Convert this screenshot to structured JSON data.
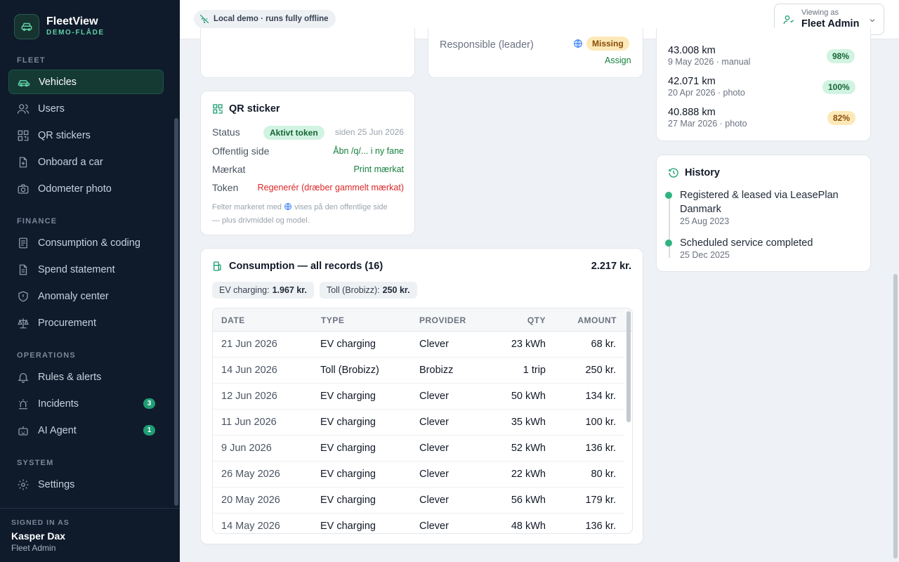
{
  "brand": {
    "name": "FleetView",
    "subtitle": "DEMO-FLÅDE"
  },
  "nav": {
    "sections": {
      "fleet": "FLEET",
      "finance": "FINANCE",
      "operations": "OPERATIONS",
      "system": "SYSTEM"
    },
    "items": {
      "vehicles": "Vehicles",
      "users": "Users",
      "qr_stickers": "QR stickers",
      "onboard": "Onboard a car",
      "odometer": "Odometer photo",
      "consumption": "Consumption & coding",
      "spend": "Spend statement",
      "anomaly": "Anomaly center",
      "procurement": "Procurement",
      "rules": "Rules & alerts",
      "incidents": "Incidents",
      "ai_agent": "AI Agent",
      "settings": "Settings"
    },
    "badges": {
      "incidents": "3",
      "ai_agent": "1"
    }
  },
  "footer": {
    "label": "SIGNED IN AS",
    "user": "Kasper Dax",
    "role": "Fleet Admin"
  },
  "topbar": {
    "demo_pill": "Local demo · runs fully offline",
    "viewing_as_label": "Viewing as",
    "viewing_as_value": "Fleet Admin"
  },
  "responsible": {
    "label": "Responsible (leader)",
    "status": "Missing",
    "action": "Assign"
  },
  "qr": {
    "title": "QR sticker",
    "status_label": "Status",
    "status_value": "Aktivt token",
    "status_since": "siden 25 Jun 2026",
    "public_label": "Offentlig side",
    "public_link": "Åbn /q/... i ny fane",
    "sticker_label": "Mærkat",
    "sticker_link": "Print mærkat",
    "token_label": "Token",
    "token_link": "Regenerér (dræber gammelt mærkat)",
    "note_a": "Felter markeret med",
    "note_b": "vises på den offentlige side",
    "note_c": "— plus drivmiddel og model."
  },
  "readings": [
    {
      "km": "43.008 km",
      "meta": "9 May 2026 · manual",
      "pct": "98%",
      "tone": "g"
    },
    {
      "km": "42.071 km",
      "meta": "20 Apr 2026 · photo",
      "pct": "100%",
      "tone": "g"
    },
    {
      "km": "40.888 km",
      "meta": "27 Mar 2026 · photo",
      "pct": "82%",
      "tone": "y"
    }
  ],
  "history": {
    "title": "History",
    "items": [
      {
        "text": "Registered & leased via LeasePlan Danmark",
        "date": "25 Aug 2023"
      },
      {
        "text": "Scheduled service completed",
        "date": "25 Dec 2025"
      }
    ]
  },
  "consumption": {
    "title": "Consumption — all records (16)",
    "total": "2.217 kr.",
    "chips": [
      {
        "label": "EV charging:",
        "value": "1.967 kr."
      },
      {
        "label": "Toll (Brobizz):",
        "value": "250 kr."
      }
    ],
    "columns": {
      "date": "DATE",
      "type": "TYPE",
      "provider": "PROVIDER",
      "qty": "QTY",
      "amount": "AMOUNT"
    },
    "rows": [
      {
        "date": "21 Jun 2026",
        "type": "EV charging",
        "provider": "Clever",
        "qty": "23 kWh",
        "amount": "68 kr."
      },
      {
        "date": "14 Jun 2026",
        "type": "Toll (Brobizz)",
        "provider": "Brobizz",
        "qty": "1 trip",
        "amount": "250 kr."
      },
      {
        "date": "12 Jun 2026",
        "type": "EV charging",
        "provider": "Clever",
        "qty": "50 kWh",
        "amount": "134 kr."
      },
      {
        "date": "11 Jun 2026",
        "type": "EV charging",
        "provider": "Clever",
        "qty": "35 kWh",
        "amount": "100 kr."
      },
      {
        "date": "9 Jun 2026",
        "type": "EV charging",
        "provider": "Clever",
        "qty": "52 kWh",
        "amount": "136 kr."
      },
      {
        "date": "26 May 2026",
        "type": "EV charging",
        "provider": "Clever",
        "qty": "22 kWh",
        "amount": "80 kr."
      },
      {
        "date": "20 May 2026",
        "type": "EV charging",
        "provider": "Clever",
        "qty": "56 kWh",
        "amount": "179 kr."
      },
      {
        "date": "14 May 2026",
        "type": "EV charging",
        "provider": "Clever",
        "qty": "48 kWh",
        "amount": "136 kr."
      }
    ]
  }
}
